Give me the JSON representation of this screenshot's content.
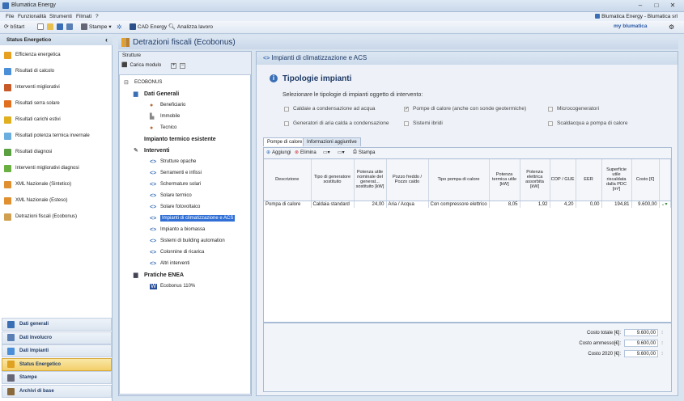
{
  "window": {
    "title": "Blumatica Energy",
    "min": "–",
    "max": "□",
    "close": "✕"
  },
  "menu": [
    "File",
    "Funzionalità",
    "Strumenti",
    "Filmati",
    "?"
  ],
  "brand": "Blumatica Energy - Blumatica srl",
  "toolbar": {
    "bstart": "bStart",
    "stampe": "Stampe",
    "cad": "CAD Energy",
    "analizza": "Analizza lavoro",
    "my": "my blumatica"
  },
  "colors": {
    "accent": "#2f6fd6",
    "active_nav": "#f3cf6a"
  },
  "left": {
    "title": "Status Energetico",
    "collapse": "‹",
    "items": [
      {
        "label": "Efficienza energetica",
        "color": "#e8a020"
      },
      {
        "label": "Risultati di calcolo",
        "color": "#4a8fd8"
      },
      {
        "label": "Interventi migliorativi",
        "color": "#c85a2a"
      },
      {
        "label": "Risultati serra solare",
        "color": "#e07020"
      },
      {
        "label": "Risultati carichi estivi",
        "color": "#e0b020"
      },
      {
        "label": "Risultati potenza termica invernale",
        "color": "#6aaee0"
      },
      {
        "label": "Risultati diagnosi",
        "color": "#5aa040"
      },
      {
        "label": "Interventi migliorativi diagnosi",
        "color": "#6ab040"
      },
      {
        "label": "XML Nazionale (Sintetico)",
        "color": "#e09030"
      },
      {
        "label": "XML Nazionale (Esteso)",
        "color": "#e09030"
      },
      {
        "label": "Detrazioni fiscali (Ecobonus)",
        "color": "#d0a050"
      }
    ],
    "nav": [
      "Dati generali",
      "Dati Involucro",
      "Dati Impianti",
      "Status Energetico",
      "Stampe",
      "Archivi di base"
    ]
  },
  "main": {
    "title": "Detrazioni fiscali (Ecobonus)"
  },
  "strutture": {
    "title": "Strutture",
    "carica": "Carica modulo",
    "tree": [
      {
        "label": "ECOBONUS",
        "lvl": 0,
        "bold": false,
        "icon": "root"
      },
      {
        "label": "Dati Generali",
        "lvl": 1,
        "bold": true,
        "icon": "book"
      },
      {
        "label": "Beneficiario",
        "lvl": 2,
        "bold": false,
        "icon": "person"
      },
      {
        "label": "Immobile",
        "lvl": 2,
        "bold": false,
        "icon": "building"
      },
      {
        "label": "Tecnico",
        "lvl": 2,
        "bold": false,
        "icon": "person"
      },
      {
        "label": "Impianto termico esistente",
        "lvl": 1,
        "bold": true,
        "icon": "none"
      },
      {
        "label": "Interventi",
        "lvl": 1,
        "bold": true,
        "icon": "tools"
      },
      {
        "label": "Strutture opache",
        "lvl": 2,
        "bold": false,
        "icon": "arrow"
      },
      {
        "label": "Serramenti e infissi",
        "lvl": 2,
        "bold": false,
        "icon": "arrow"
      },
      {
        "label": "Schermature solari",
        "lvl": 2,
        "bold": false,
        "icon": "arrow"
      },
      {
        "label": "Solare termico",
        "lvl": 2,
        "bold": false,
        "icon": "arrow"
      },
      {
        "label": "Solare fotovoltaico",
        "lvl": 2,
        "bold": false,
        "icon": "arrow"
      },
      {
        "label": "Impianti di climatizzazione e ACS",
        "lvl": 2,
        "bold": false,
        "icon": "arrow",
        "sel": true
      },
      {
        "label": "Impianto a biomassa",
        "lvl": 2,
        "bold": false,
        "icon": "arrow"
      },
      {
        "label": "Sistemi di building automation",
        "lvl": 2,
        "bold": false,
        "icon": "arrow"
      },
      {
        "label": "Colonnine di ricarica",
        "lvl": 2,
        "bold": false,
        "icon": "arrow"
      },
      {
        "label": "Altri interventi",
        "lvl": 2,
        "bold": false,
        "icon": "arrow"
      },
      {
        "label": "Pratiche ENEA",
        "lvl": 1,
        "bold": true,
        "icon": "doc"
      },
      {
        "label": "Ecobonus 110%",
        "lvl": 2,
        "bold": false,
        "icon": "word"
      }
    ]
  },
  "right": {
    "header": "Impianti di climatizzazione e ACS",
    "section": "Tipologie impianti",
    "prompt": "Selezionare le tipologie di impianti oggetto di intervento:",
    "options": [
      {
        "label": "Caldaie a condensazione ad acqua",
        "checked": false
      },
      {
        "label": "Pompe di calore (anche con sonde geotermiche)",
        "checked": true
      },
      {
        "label": "Microcogeneratori",
        "checked": false
      },
      {
        "label": "Generatori di aria calda a condensazione",
        "checked": false
      },
      {
        "label": "Sistemi ibridi",
        "checked": false
      },
      {
        "label": "Scaldacqua a pompa di calore",
        "checked": false
      }
    ],
    "tabs": [
      "Pompe di calore",
      "Informazioni aggiuntive"
    ],
    "gridbar": {
      "add": "Aggiungi",
      "del": "Elimina",
      "print": "Stampa"
    },
    "columns": [
      "Descrizione",
      "Tipo di generatore sostituito",
      "Potenza utile nominale del generat... sostituito [kW]",
      "Pozzo freddo / Pozzo caldo",
      "Tipo pompa di calore",
      "Potenza termica utile [kW]",
      "Potenza elettrica assorbita [kW]",
      "COP / GUE",
      "EER",
      "Superficie utile riscaldata dalla PDC [m²]",
      "Costo [€]"
    ],
    "rows": [
      [
        "Pompa di calore",
        "Caldaia standard",
        "24,00",
        "Aria / Acqua",
        "Con compressore elettrico",
        "8,05",
        "1,92",
        "4,20",
        "0,00",
        "194,81",
        "9.600,00"
      ]
    ],
    "totals": [
      {
        "label": "Costo totale [€]:",
        "value": "9.600,00"
      },
      {
        "label": "Costo ammesso[€]:",
        "value": "9.600,00"
      },
      {
        "label": "Costo 2020 [€]:",
        "value": "9.600,00"
      }
    ]
  }
}
